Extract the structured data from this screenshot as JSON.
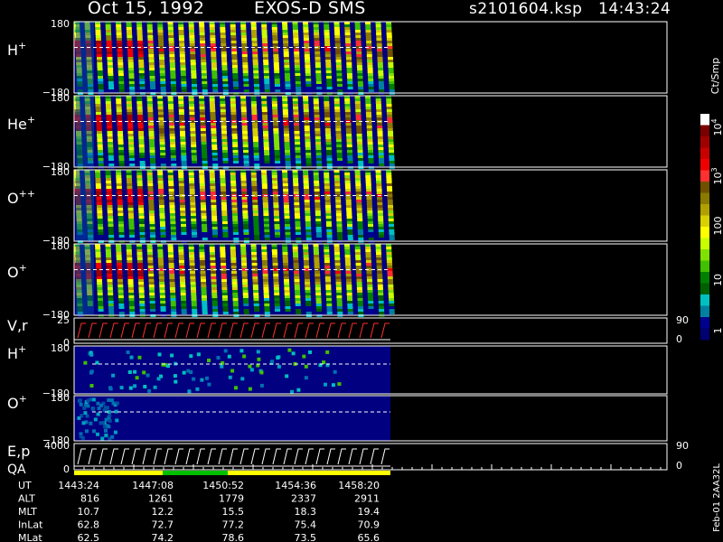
{
  "header": {
    "date": "Oct 15, 1992",
    "instrument": "EXOS-D SMS",
    "file": "s2101604.ksp",
    "time": "14:43:24"
  },
  "panels": [
    {
      "id": "h",
      "label": "H",
      "sup": "+",
      "y_top": "180",
      "y_bottom": "−180"
    },
    {
      "id": "he",
      "label": "He",
      "sup": "+",
      "y_top": "180",
      "y_bottom": "−180"
    },
    {
      "id": "opp",
      "label": "O",
      "sup": "++",
      "y_top": "180",
      "y_bottom": "−180"
    },
    {
      "id": "op",
      "label": "O",
      "sup": "+",
      "y_top": "180",
      "y_bottom": "−180"
    },
    {
      "id": "vr",
      "label": "V,r",
      "sup": "",
      "y_top": "25",
      "y_bottom": "0",
      "right_top": "90",
      "right_bottom": "0"
    },
    {
      "id": "h2",
      "label": "H",
      "sup": "+",
      "y_top": "180",
      "y_bottom": "−180"
    },
    {
      "id": "o2",
      "label": "O",
      "sup": "+",
      "y_top": "180",
      "y_bottom": "−180"
    },
    {
      "id": "ep",
      "label": "E,p",
      "sup": "",
      "y_top": "4000",
      "y_bottom": "0",
      "right_top": "90",
      "right_bottom": "0"
    }
  ],
  "qa_label": "QA",
  "colorbar": {
    "unit": "Ct/Smp",
    "labels": [
      {
        "base": "10",
        "exp": "4"
      },
      {
        "base": "10",
        "exp": "3"
      },
      {
        "base": "100",
        "exp": ""
      },
      {
        "base": "10",
        "exp": ""
      },
      {
        "base": "1",
        "exp": ""
      }
    ],
    "colors": [
      "#ffffff",
      "#7a0000",
      "#a00000",
      "#c80000",
      "#f00000",
      "#ff3030",
      "#705000",
      "#8a7a00",
      "#b0a000",
      "#d8d000",
      "#ffff00",
      "#c8ff00",
      "#80e000",
      "#40c000",
      "#008000",
      "#006000",
      "#00c0c0",
      "#0080a0",
      "#000090",
      "#000070"
    ]
  },
  "orbit": {
    "rows": [
      {
        "label": "UT",
        "values": [
          "1443:24",
          "1447:08",
          "1450:52",
          "1454:36",
          "1458:20"
        ]
      },
      {
        "label": "ALT",
        "values": [
          "816",
          "1261",
          "1779",
          "2337",
          "2911"
        ]
      },
      {
        "label": "MLT",
        "values": [
          "10.7",
          "12.2",
          "15.5",
          "18.3",
          "19.4"
        ]
      },
      {
        "label": "InLat",
        "values": [
          "62.8",
          "72.7",
          "77.2",
          "75.4",
          "70.9"
        ]
      },
      {
        "label": "MLat",
        "values": [
          "62.5",
          "74.2",
          "78.6",
          "73.5",
          "65.6"
        ]
      }
    ]
  },
  "side_note": "Feb-01 2AA32L",
  "chart_data": {
    "type": "heatmap",
    "title": "Oct 15, 1992  EXOS-D SMS",
    "xlabel": "UT",
    "x_ticks": [
      "1443:24",
      "1447:08",
      "1450:52",
      "1454:36",
      "1458:20"
    ],
    "ylim": [
      -180,
      180
    ],
    "colorscale": {
      "unit": "Ct/Smp",
      "range": [
        1,
        10000
      ],
      "scale": "log"
    },
    "series": [
      {
        "name": "H+",
        "ylim": [
          -180,
          180
        ]
      },
      {
        "name": "He+",
        "ylim": [
          -180,
          180
        ]
      },
      {
        "name": "O++",
        "ylim": [
          -180,
          180
        ]
      },
      {
        "name": "O+",
        "ylim": [
          -180,
          180
        ]
      },
      {
        "name": "V,r",
        "ylim": [
          0,
          25
        ],
        "right_ylim": [
          0,
          90
        ]
      },
      {
        "name": "H+",
        "ylim": [
          -180,
          180
        ]
      },
      {
        "name": "O+",
        "ylim": [
          -180,
          180
        ]
      },
      {
        "name": "E,p",
        "ylim": [
          0,
          4000
        ],
        "right_ylim": [
          0,
          90
        ]
      }
    ]
  }
}
